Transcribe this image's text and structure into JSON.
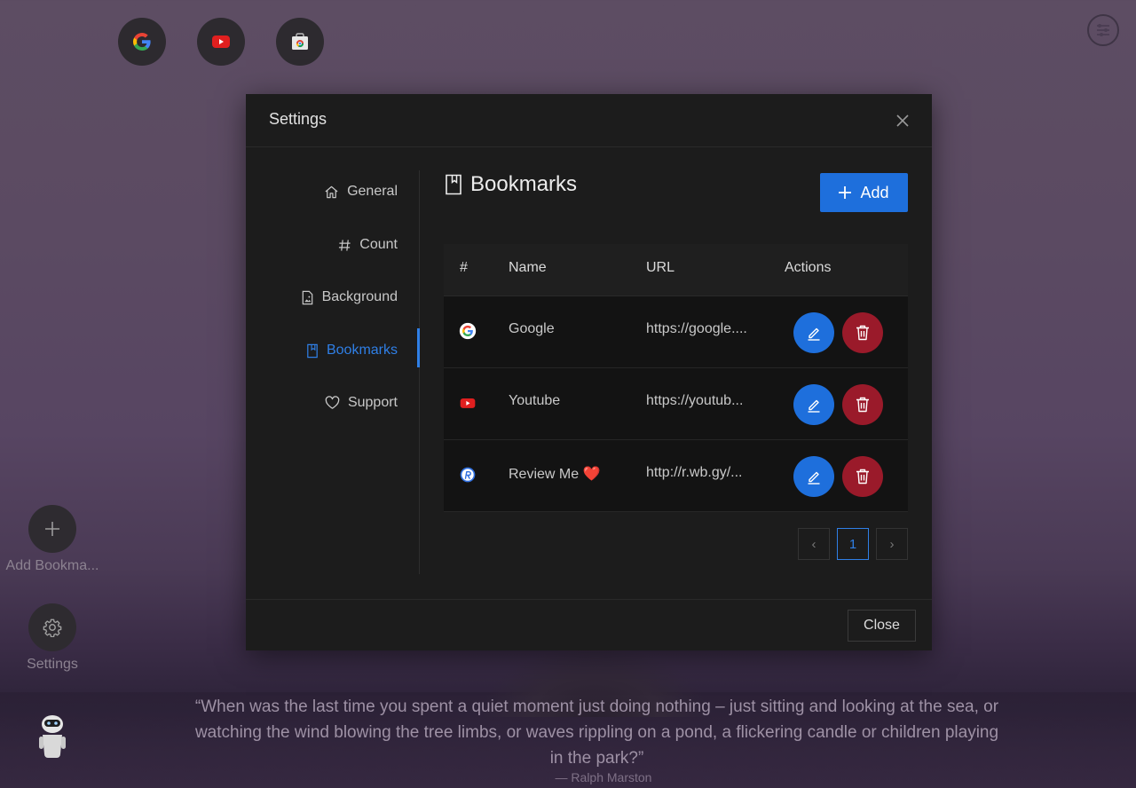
{
  "shortcuts": [
    {
      "icon": "google-icon"
    },
    {
      "icon": "youtube-icon"
    },
    {
      "icon": "web-store-icon"
    }
  ],
  "sidebar": {
    "add_bookmark_label": "Add Bookma...",
    "settings_label": "Settings"
  },
  "quote": {
    "text": "“When was the last time you spent a quiet moment just doing nothing – just sitting and looking at the sea, or watching the wind blowing the tree limbs, or waves rippling on a pond, a flickering candle or children playing in the park?”",
    "author": "— Ralph Marston"
  },
  "modal": {
    "title": "Settings",
    "menu": [
      {
        "label": "General",
        "icon": "home-icon"
      },
      {
        "label": "Count",
        "icon": "hash-icon"
      },
      {
        "label": "Background",
        "icon": "image-file-icon"
      },
      {
        "label": "Bookmarks",
        "icon": "bookmark-icon",
        "active": true
      },
      {
        "label": "Support",
        "icon": "heart-icon"
      }
    ],
    "section_title": "Bookmarks",
    "add_label": "Add",
    "table": {
      "headers": [
        "#",
        "Name",
        "URL",
        "Actions"
      ],
      "rows": [
        {
          "icon": "google-favicon",
          "name": "Google",
          "url": "https://google...."
        },
        {
          "icon": "youtube-favicon",
          "name": "Youtube",
          "url": "https://youtub..."
        },
        {
          "icon": "review-me-favicon",
          "name": "Review Me ❤️",
          "url": "http://r.wb.gy/..."
        }
      ]
    },
    "pagination": {
      "prev": "‹",
      "current": "1",
      "next": "›"
    },
    "close_label": "Close"
  },
  "colors": {
    "accent": "#1e6fdc",
    "danger": "#9a1a2a",
    "modal_bg": "#1c1c1c"
  }
}
